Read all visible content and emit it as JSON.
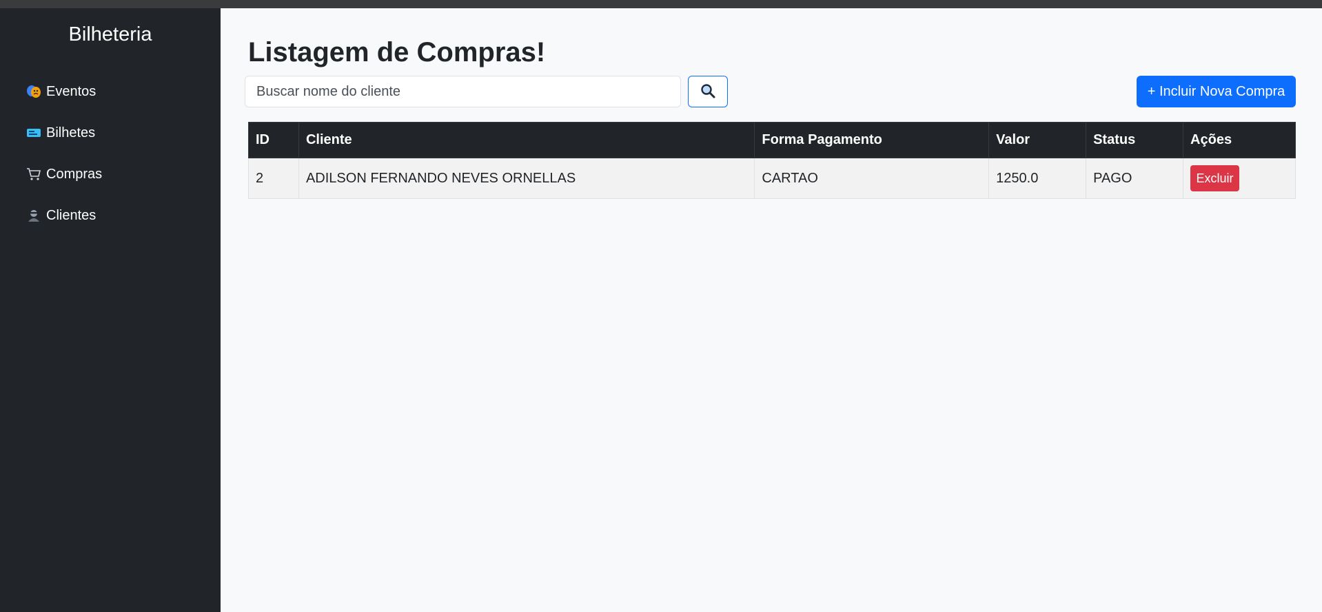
{
  "sidebar": {
    "brand": "Bilheteria",
    "items": [
      {
        "label": "Eventos",
        "icon": "theater-masks-icon"
      },
      {
        "label": "Bilhetes",
        "icon": "ticket-icon"
      },
      {
        "label": "Compras",
        "icon": "shopping-cart-icon"
      },
      {
        "label": "Clientes",
        "icon": "person-icon"
      }
    ]
  },
  "main": {
    "title": "Listagem de Compras!",
    "search": {
      "placeholder": "Buscar nome do cliente",
      "value": ""
    },
    "add_button": "+ Incluir Nova Compra",
    "table": {
      "headers": [
        "ID",
        "Cliente",
        "Forma Pagamento",
        "Valor",
        "Status",
        "Ações"
      ],
      "rows": [
        {
          "id": "2",
          "cliente": "ADILSON FERNANDO NEVES ORNELLAS",
          "forma_pagamento": "CARTAO",
          "valor": "1250.0",
          "status": "PAGO",
          "action": "Excluir"
        }
      ]
    }
  },
  "colors": {
    "sidebar_bg": "#212529",
    "primary": "#0d6efd",
    "danger": "#dc3545"
  }
}
